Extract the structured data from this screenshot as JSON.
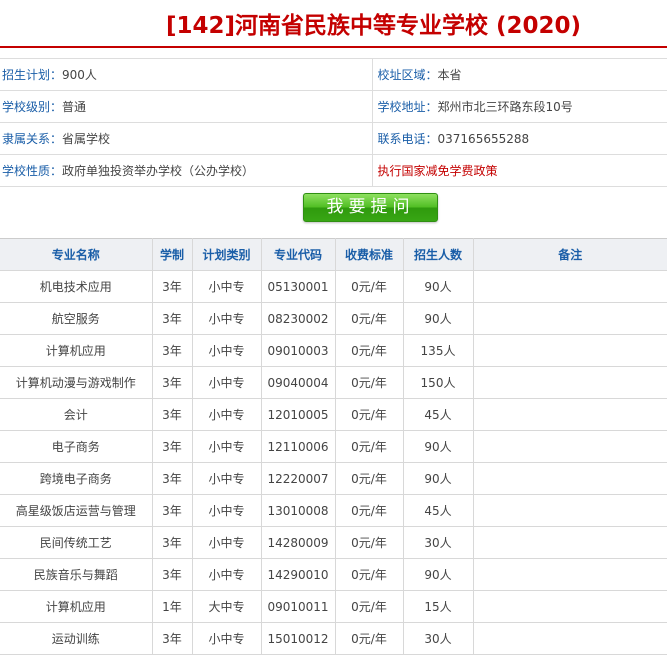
{
  "page": {
    "title": "[142]河南省民族中等专业学校 (2020)"
  },
  "info": [
    {
      "left_key": "招生计划：",
      "left_value": "900人",
      "right_key": "校址区域：",
      "right_value": "本省"
    },
    {
      "left_key": "学校级别：",
      "left_value": "普通",
      "right_key": "学校地址：",
      "right_value": "郑州市北三环路东段10号"
    },
    {
      "left_key": "隶属关系：",
      "left_value": "省属学校",
      "right_key": "联系电话：",
      "right_value": "037165655288"
    },
    {
      "left_key": "学校性质：",
      "left_value": "政府单独投资举办学校（公办学校）",
      "policy": "执行国家减免学费政策"
    }
  ],
  "ask_button": {
    "label": "我要提问"
  },
  "majors_table": {
    "headers": [
      "专业名称",
      "学制",
      "计划类别",
      "专业代码",
      "收费标准",
      "招生人数",
      "备注"
    ],
    "rows": [
      {
        "name": "机电技术应用",
        "years": "3年",
        "category": "小中专",
        "code": "05130001",
        "fee": "0元/年",
        "enroll": "90人",
        "note": ""
      },
      {
        "name": "航空服务",
        "years": "3年",
        "category": "小中专",
        "code": "08230002",
        "fee": "0元/年",
        "enroll": "90人",
        "note": ""
      },
      {
        "name": "计算机应用",
        "years": "3年",
        "category": "小中专",
        "code": "09010003",
        "fee": "0元/年",
        "enroll": "135人",
        "note": ""
      },
      {
        "name": "计算机动漫与游戏制作",
        "years": "3年",
        "category": "小中专",
        "code": "09040004",
        "fee": "0元/年",
        "enroll": "150人",
        "note": ""
      },
      {
        "name": "会计",
        "years": "3年",
        "category": "小中专",
        "code": "12010005",
        "fee": "0元/年",
        "enroll": "45人",
        "note": ""
      },
      {
        "name": "电子商务",
        "years": "3年",
        "category": "小中专",
        "code": "12110006",
        "fee": "0元/年",
        "enroll": "90人",
        "note": ""
      },
      {
        "name": "跨境电子商务",
        "years": "3年",
        "category": "小中专",
        "code": "12220007",
        "fee": "0元/年",
        "enroll": "90人",
        "note": ""
      },
      {
        "name": "高星级饭店运营与管理",
        "years": "3年",
        "category": "小中专",
        "code": "13010008",
        "fee": "0元/年",
        "enroll": "45人",
        "note": ""
      },
      {
        "name": "民间传统工艺",
        "years": "3年",
        "category": "小中专",
        "code": "14280009",
        "fee": "0元/年",
        "enroll": "30人",
        "note": ""
      },
      {
        "name": "民族音乐与舞蹈",
        "years": "3年",
        "category": "小中专",
        "code": "14290010",
        "fee": "0元/年",
        "enroll": "90人",
        "note": ""
      },
      {
        "name": "计算机应用",
        "years": "1年",
        "category": "大中专",
        "code": "09010011",
        "fee": "0元/年",
        "enroll": "15人",
        "note": ""
      },
      {
        "name": "运动训练",
        "years": "3年",
        "category": "小中专",
        "code": "15010012",
        "fee": "0元/年",
        "enroll": "30人",
        "note": ""
      }
    ]
  }
}
